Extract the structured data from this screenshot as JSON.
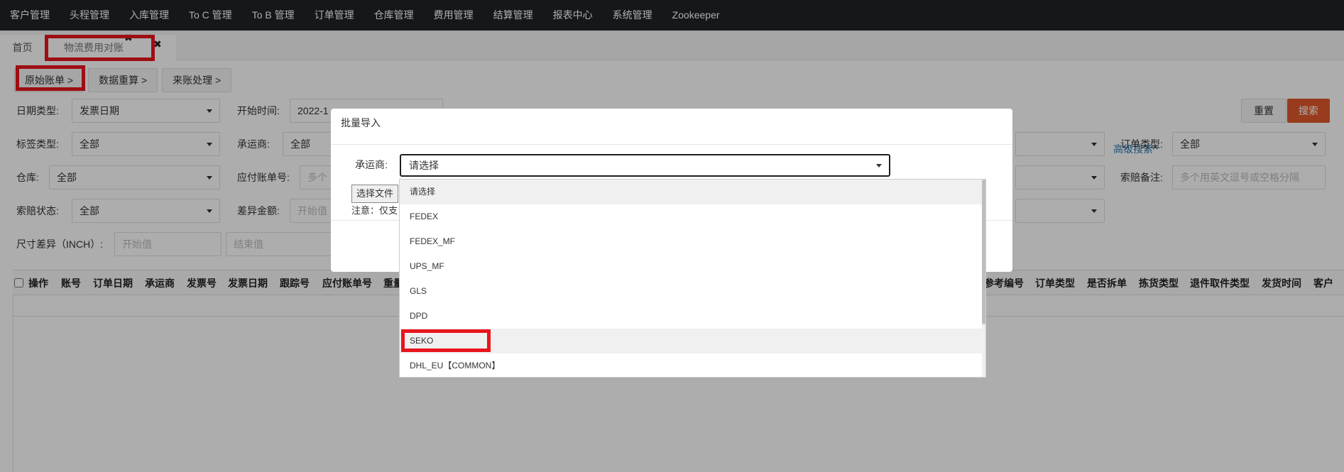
{
  "topnav": {
    "items": [
      "客户管理",
      "头程管理",
      "入库管理",
      "To C 管理",
      "To B 管理",
      "订单管理",
      "仓库管理",
      "费用管理",
      "结算管理",
      "报表中心",
      "系统管理",
      "Zookeeper"
    ]
  },
  "tabs": {
    "home": "首页",
    "active": "物流费用对账",
    "close_glyph": "✖"
  },
  "subtabs": [
    "原始账单 >",
    "数据重算 >",
    "来账处理 >"
  ],
  "filters": {
    "date_type_label": "日期类型:",
    "date_type_value": "发票日期",
    "start_time_label": "开始时间:",
    "start_time_value": "2022-1",
    "advanced_search": "高级搜索^",
    "reset": "重置",
    "search": "搜索",
    "tag_type_label": "标签类型:",
    "tag_type_value": "全部",
    "carrier_label": "承运商:",
    "carrier_value": "全部",
    "order_type_label": "订单类型:",
    "order_type_value": "全部",
    "warehouse_label": "仓库:",
    "warehouse_value": "全部",
    "payable_bill_label": "应付账单号:",
    "payable_bill_placeholder": "多个",
    "claim_note_label": "索赔备注:",
    "claim_note_placeholder": "多个用英文逗号或空格分隔",
    "claim_status_label": "索赔状态:",
    "claim_status_value": "全部",
    "diff_amount_label": "差异金额:",
    "diff_amount_placeholder": "开始值",
    "size_diff_label": "尺寸差异（INCH）:",
    "size_start_placeholder": "开始值",
    "size_end_placeholder": "结束值"
  },
  "table": {
    "columns_left": [
      "操作",
      "账号",
      "订单日期",
      "承运商",
      "发票号",
      "发票日期",
      "跟踪号",
      "应付账单号",
      "重量"
    ],
    "columns_right": [
      "参考编号",
      "订单类型",
      "是否拆单",
      "拣货类型",
      "退件取件类型",
      "发货时间",
      "客户"
    ]
  },
  "modal": {
    "title": "批量导入",
    "carrier_label": "承运商:",
    "carrier_selected": "请选择",
    "file_button": "选择文件",
    "note": "注意：仅支",
    "cancel_partial": "消"
  },
  "dropdown": {
    "options": [
      "请选择",
      "FEDEX",
      "FEDEX_MF",
      "UPS_MF",
      "GLS",
      "DPD",
      "SEKO",
      "DHL_EU【COMMON】"
    ],
    "hovered": "SEKO"
  }
}
